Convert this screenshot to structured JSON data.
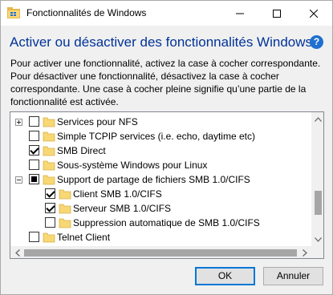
{
  "window": {
    "title": "Fonctionnalités de Windows",
    "header": "Activer ou désactiver des fonctionnalités Windows",
    "help_label": "?",
    "description": "Pour activer une fonctionnalité, activez la case à cocher correspondante. Pour désactiver une fonctionnalité, désactivez la case à cocher correspondante. Une case à cocher pleine signifie qu’une partie de la fonctionnalité est activée."
  },
  "features": [
    {
      "label": "Services pour NFS",
      "state": "unchecked",
      "expander": "plus",
      "level": 0
    },
    {
      "label": "Simple TCPIP services (i.e. echo, daytime etc)",
      "state": "unchecked",
      "expander": "none",
      "level": 0
    },
    {
      "label": "SMB Direct",
      "state": "checked",
      "expander": "none",
      "level": 0
    },
    {
      "label": "Sous-système Windows pour Linux",
      "state": "unchecked",
      "expander": "none",
      "level": 0
    },
    {
      "label": "Support de partage de fichiers SMB 1.0/CIFS",
      "state": "partial",
      "expander": "minus",
      "level": 0
    },
    {
      "label": "Client SMB 1.0/CIFS",
      "state": "checked",
      "expander": "none",
      "level": 1
    },
    {
      "label": "Serveur SMB 1.0/CIFS",
      "state": "checked",
      "expander": "none",
      "level": 1
    },
    {
      "label": "Suppression automatique de SMB 1.0/CIFS",
      "state": "unchecked",
      "expander": "none",
      "level": 1
    },
    {
      "label": "Telnet Client",
      "state": "unchecked",
      "expander": "none",
      "level": 0
    }
  ],
  "buttons": {
    "ok": "OK",
    "cancel": "Annuler"
  },
  "colors": {
    "header": "#003399",
    "accent": "#0078d7",
    "folder": "#f8d775",
    "help": "#1f6fd1"
  },
  "icons": {
    "app": "windows-features-icon",
    "help": "help-icon",
    "folder": "folder-icon"
  }
}
